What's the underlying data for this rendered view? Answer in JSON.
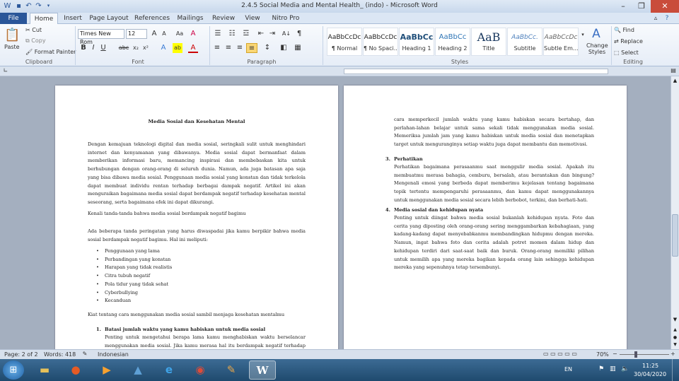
{
  "window": {
    "title": "2.4.5 Social Media and Mental Health_ (indo) - Microsoft Word"
  },
  "tabs": [
    "File",
    "Home",
    "Insert",
    "Page Layout",
    "References",
    "Mailings",
    "Review",
    "View",
    "Nitro Pro"
  ],
  "ribbon": {
    "clipboard": {
      "paste": "Paste",
      "cut": "Cut",
      "copy": "Copy",
      "format_painter": "Format Painter",
      "label": "Clipboard"
    },
    "font": {
      "name": "Times New Rom",
      "size": "12",
      "label": "Font"
    },
    "paragraph": {
      "label": "Paragraph"
    },
    "styles": {
      "label": "Styles",
      "items": [
        {
          "sample": "AaBbCcDc",
          "name": "¶ Normal"
        },
        {
          "sample": "AaBbCcDc",
          "name": "¶ No Spaci..."
        },
        {
          "sample": "AaBbCc",
          "name": "Heading 1"
        },
        {
          "sample": "AaBbCc",
          "name": "Heading 2"
        },
        {
          "sample": "AaB",
          "name": "Title"
        },
        {
          "sample": "AaBbCc.",
          "name": "Subtitle"
        },
        {
          "sample": "AaBbCcDc",
          "name": "Subtle Em..."
        }
      ],
      "change_styles": "Change Styles"
    },
    "editing": {
      "find": "Find",
      "replace": "Replace",
      "select": "Select",
      "label": "Editing"
    }
  },
  "page1": {
    "title": "Media Sosial dan Kesehatan Mental",
    "intro": "Dengan kemajuan teknologi digital dan media sosial, seringkali sulit untuk menghindari internet dan kenyamanan yang dibawanya. Media sosial dapat bermanfaat dalam memberikan informasi baru, memancing inspirasi dan membebaskan kita untuk berhubungan dengan orang-orang di seluruh dunia. Namun, ada juga batasan apa saja yang bisa dibawa media sosial. Penggunaan media sosial yang konstan dan tidak terkelola dapat membuat individu rentan terhadap berbagai dampak negatif. Artikel ini akan menguraikan bagaimana media sosial dapat berdampak negatif terhadap kesehatan mental seseorang, serta bagaimana efek ini dapat dikurangi.",
    "signs_heading": "Kenali tanda-tanda bahwa media sosial berdampak negatif bagimu",
    "signs_intro": "Ada beberapa tanda peringatan yang harus diwaspadai jika kamu berpikir bahwa media sosial berdampak negatif bagimu. Hal ini meliputi:",
    "signs": [
      "Penggunaan yang lama",
      "Perbandingan yang konstan",
      "Harapan yang tidak realistis",
      "Citra tubuh negatif",
      "Pola tidur yang tidak sehat",
      "Cyberbullying",
      "Kecanduan"
    ],
    "tips_heading": "Kiat tentang cara menggunakan media sosial sambil menjaga kesehatan mentalmu",
    "tip1_num": "1.",
    "tip1_title": "Batasi jumlah waktu yang kamu habiskan untuk media sosial",
    "tip1_body": "Penting untuk mengetahui berapa lama kamu menghabiskan waktu berselancar menggunakan media sosial. Jika kamu merasa hal itu berdampak negatif terhadap suasana hatimu atau kesehatan mentalmu, mungkin akan membantu jika kamu"
  },
  "page2": {
    "cont": "cara memperkecil jumlah waktu yang kamu habiskan secara bertahap, dan perlahan-lahan belajar untuk sama sekali tidak menggunakan media sosial. Memeriksa jumlah jam yang kamu habiskan untuk media sosial dan menetapkan target untuk menguranginya setiap waktu juga dapat membantu dan memotivasi.",
    "tip3_num": "3.",
    "tip3_title": "Perhatikan",
    "tip3_body": "Perhatikan bagaimana perasaanmu saat menggulir media sosial. Apakah itu membuatmu merasa bahagia, cemburu, bersalah, atau berantakan dan bingung? Mengenali emosi yang berbeda dapat memberimu kejelasan tentang bagaimana topik tertentu mempengaruhi perasaanmu, dan kamu dapat menggunakannya untuk menggunakan media sosial secara lebih berbobot, terkini, dan berhati-hati.",
    "tip4_num": "4.",
    "tip4_title": "Media sosial dan kehidupan nyata",
    "tip4_body": "Penting untuk diingat bahwa media sosial bukanlah kehidupan nyata. Foto dan cerita yang diposting oleh orang-orang sering menggambarkan kebahagiaan, yang kadang-kadang dapat menyebabkanmu membandingkan hidupmu dengan mereka. Namun, ingat bahwa foto dan cerita adalah potret momen dalam hidup dan kehidupan terdiri dari saat-saat baik dan buruk. Orang-orang memiliki pilihan untuk memilih apa yang mereka bagikan kepada orang lain sehingga kehidupan mereka yang sepenuhnya tetap tersembunyi."
  },
  "status": {
    "page": "Page: 2 of 2",
    "words": "Words: 418",
    "language": "Indonesian",
    "zoom": "70%"
  },
  "taskbar": {
    "lang": "EN",
    "time": "11:25",
    "date": "30/04/2020"
  }
}
